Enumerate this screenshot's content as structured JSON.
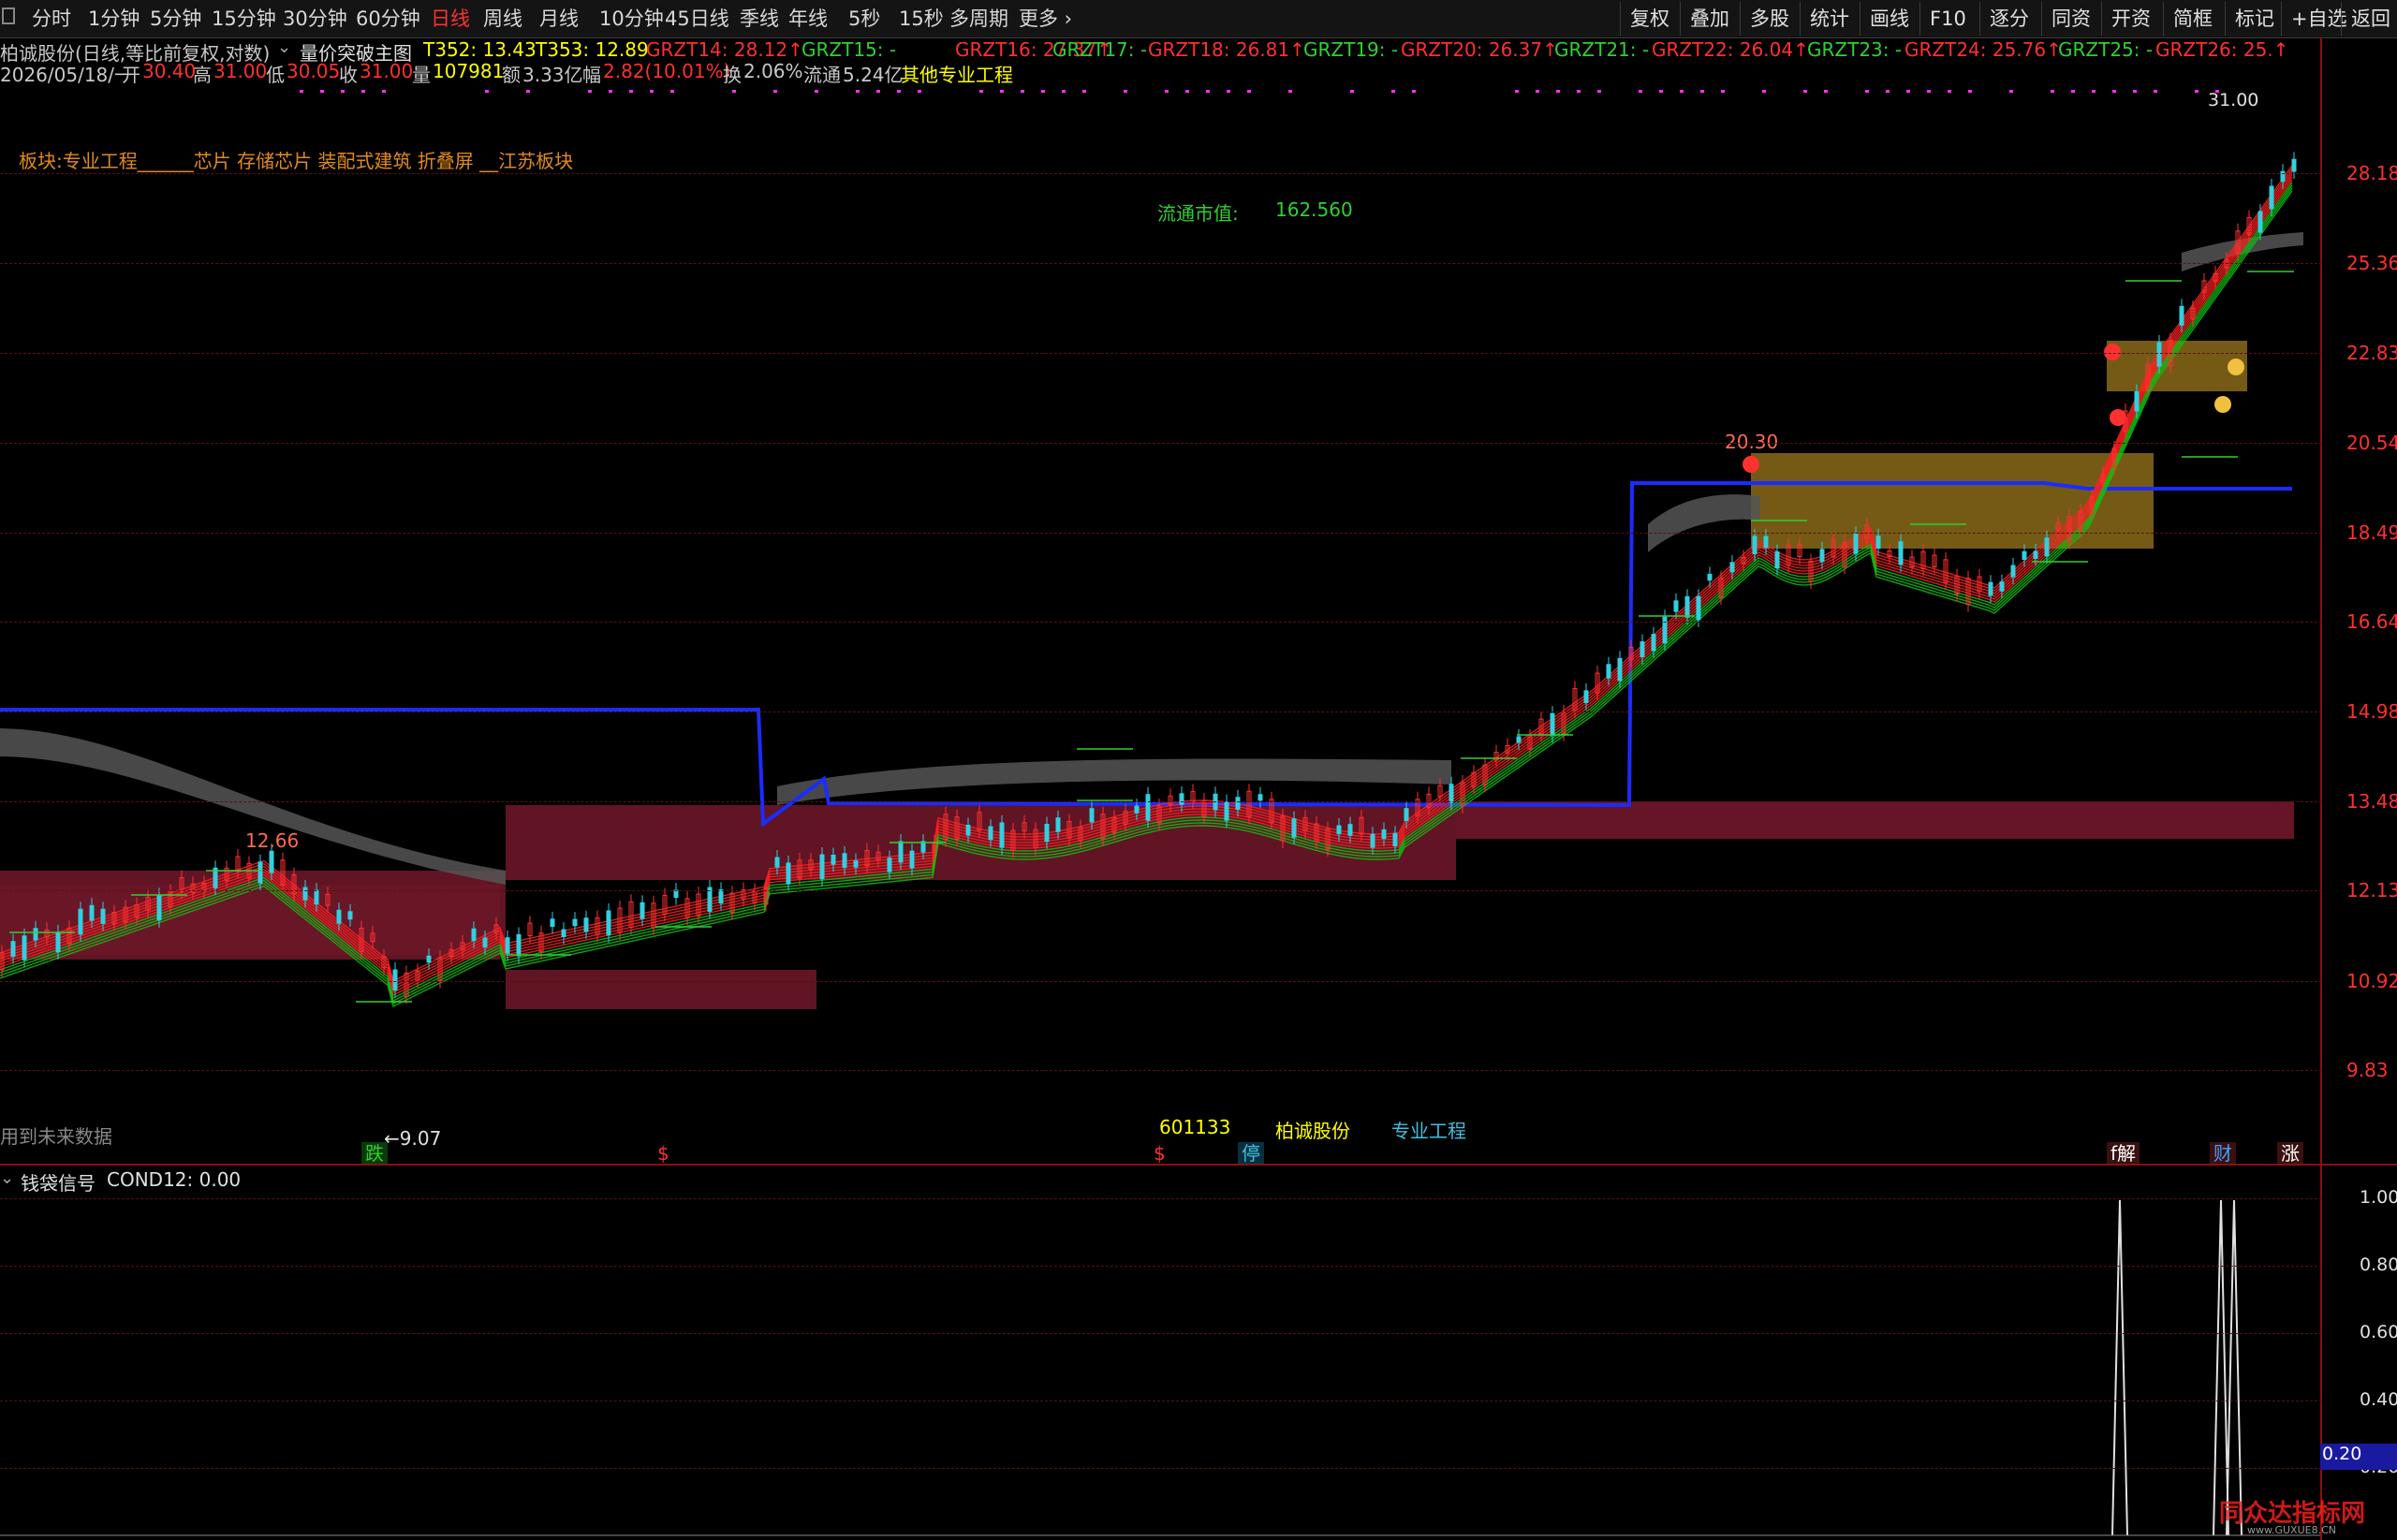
{
  "toolbar": {
    "left_items": [
      "分时",
      "1分钟",
      "5分钟",
      "15分钟",
      "30分钟",
      "60分钟",
      "日线",
      "周线",
      "月线",
      "10分钟",
      "45日线",
      "季线",
      "年线",
      "5秒",
      "15秒",
      "多周期",
      "更多"
    ],
    "active_item": "日线",
    "right_items": [
      "复权",
      "叠加",
      "多股",
      "统计",
      "画线",
      "F10",
      "逐分",
      "同资",
      "开资",
      "简框",
      "标记",
      "+自选",
      "返回"
    ]
  },
  "header": {
    "title": "柏诚股份(日线,等比前复权,对数)",
    "indicator_name": "量价突破主图",
    "indicators": [
      {
        "label": "T352: 13.43",
        "color": "#ffff00"
      },
      {
        "label": "T353: 12.89",
        "color": "#ffff00"
      },
      {
        "label": "GRZT14: 28.12",
        "color": "#ff3030"
      },
      {
        "label": "GRZT15: -",
        "color": "#30d030"
      },
      {
        "label": "GRZT16: 27.37",
        "color": "#ff3030"
      },
      {
        "label": "GRZT17: -",
        "color": "#30d030"
      },
      {
        "label": "GRZT18: 26.81",
        "color": "#ff3030"
      },
      {
        "label": "GRZT19: -",
        "color": "#30d030"
      },
      {
        "label": "GRZT20: 26.37",
        "color": "#ff3030"
      },
      {
        "label": "GRZT21: -",
        "color": "#30d030"
      },
      {
        "label": "GRZT22: 26.04",
        "color": "#ff3030"
      },
      {
        "label": "GRZT23: -",
        "color": "#30d030"
      },
      {
        "label": "GRZT24: 25.76",
        "color": "#ff3030"
      },
      {
        "label": "GRZT25: -",
        "color": "#30d030"
      },
      {
        "label": "GRZT26: 25.",
        "color": "#ff3030"
      }
    ]
  },
  "quote": {
    "date": "2026/05/18/一",
    "open_label": "开",
    "open": "30.40",
    "high_label": "高",
    "high": "31.00",
    "low_label": "低",
    "low": "30.05",
    "close_label": "收",
    "close": "31.00",
    "volume_label": "量",
    "volume": "107981",
    "amount_label": "额",
    "amount": "3.33亿",
    "change_label": "幅",
    "change": "2.82(10.01%)",
    "turnover_label": "换",
    "turnover": "2.06%",
    "float_label": "流通",
    "float": "5.24亿",
    "sector": "其他专业工程"
  },
  "sector_line": "板块:专业工程______芯片 存储芯片 装配式建筑 折叠屏 __江苏板块",
  "float_cap": {
    "label": "流通市值:",
    "value": "162.560"
  },
  "price_marker": "31.00",
  "y_axis_ticks": [
    "28.18",
    "25.36",
    "22.83",
    "20.54",
    "18.49",
    "16.64",
    "14.98",
    "13.48",
    "12.13",
    "10.92",
    "9.83"
  ],
  "annotations": {
    "high_left": "12.66",
    "low_mark": "←9.07",
    "peak_mid": "20.30",
    "future_warning": "用到未来数据"
  },
  "stock_info": {
    "code": "601133",
    "name": "柏诚股份",
    "sector": "专业工程"
  },
  "bottom_badges": [
    {
      "label": "跌",
      "color": "#30d030"
    },
    {
      "label": "$",
      "color": "#ff3030"
    },
    {
      "label": "$",
      "color": "#ff3030"
    },
    {
      "label": "停",
      "color": "#40c0e0"
    },
    {
      "label": "f解",
      "color": "#ffffff"
    },
    {
      "label": "财",
      "color": "#40a0ff"
    },
    {
      "label": "涨",
      "color": "#ffffff"
    }
  ],
  "sub_panel": {
    "title": "钱袋信号",
    "value_label": "COND12: 0.00",
    "y_ticks": [
      "1.00",
      "0.80",
      "0.60",
      "0.40",
      "0.20"
    ],
    "current_value": "0.20"
  },
  "watermark": "同众达指标网",
  "watermark_url": "www.GUXUE8.CN",
  "colors": {
    "up": "#ff3030",
    "down": "#30d0e0",
    "breakout_line": "#1a2cff",
    "support_zone": "#6a1628",
    "resist_zone": "#8a6a1a",
    "ribbon_up": "#ff2020",
    "ribbon_down": "#10c010",
    "ribbon_grey": "#555555"
  }
}
